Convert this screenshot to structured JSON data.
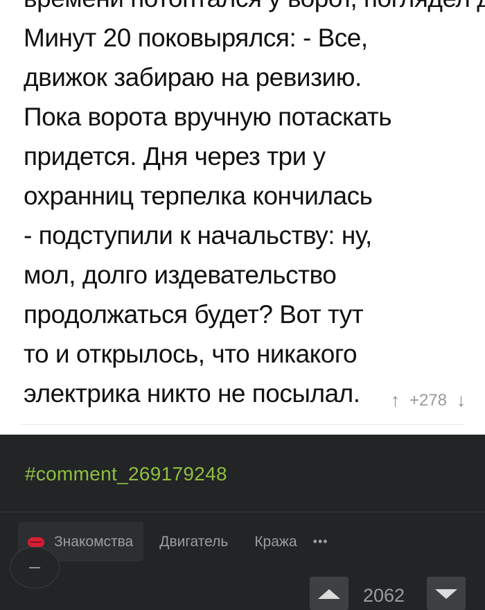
{
  "post": {
    "lines": [
      "времени потоптался у ворот, поглядел дрели.",
      "Минут 20 поковырялся: - Все,",
      "движок забираю на ревизию.",
      "Пока ворота вручную потаскать",
      "придется. Дня через три у",
      "охранниц терпелка кончилась",
      "- подступили к начальству: ну,",
      "мол, долго издевательство",
      "продолжаться будет? Вот тут",
      "то и открылось, что никакого",
      "электрика никто не посылал."
    ],
    "votes": {
      "up_icon": "arrow-up-icon",
      "value": "+278",
      "down_icon": "arrow-down-icon"
    }
  },
  "comment": {
    "link_text": "#comment_269179248"
  },
  "tags": [
    {
      "label": "Знакомства",
      "icon": "lips-icon"
    },
    {
      "label": "Двигатель"
    },
    {
      "label": "Кража"
    }
  ],
  "more_label": "•••",
  "rating": {
    "count": "2062"
  },
  "colors": {
    "accent_link": "#8fbf3f",
    "dark_bg": "#222426",
    "lips": "#d61f35"
  }
}
